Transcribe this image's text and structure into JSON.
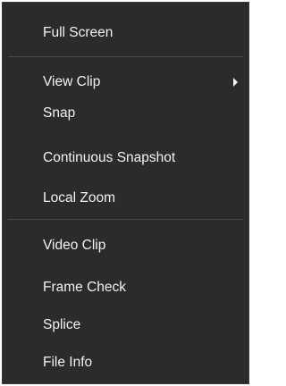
{
  "menu": {
    "items": [
      {
        "label": "Full Screen"
      },
      {
        "label": "View Clip",
        "has_submenu": true
      },
      {
        "label": "Snap"
      },
      {
        "label": "Continuous Snapshot"
      },
      {
        "label": "Local Zoom"
      },
      {
        "label": "Video Clip"
      },
      {
        "label": "Frame Check"
      },
      {
        "label": "Splice"
      },
      {
        "label": "File Info"
      }
    ],
    "submenu_icon": "chevron-right-icon",
    "colors": {
      "background": "#2b2b2b",
      "text": "#f2f2f2",
      "separator": "#4a4a4a"
    }
  }
}
